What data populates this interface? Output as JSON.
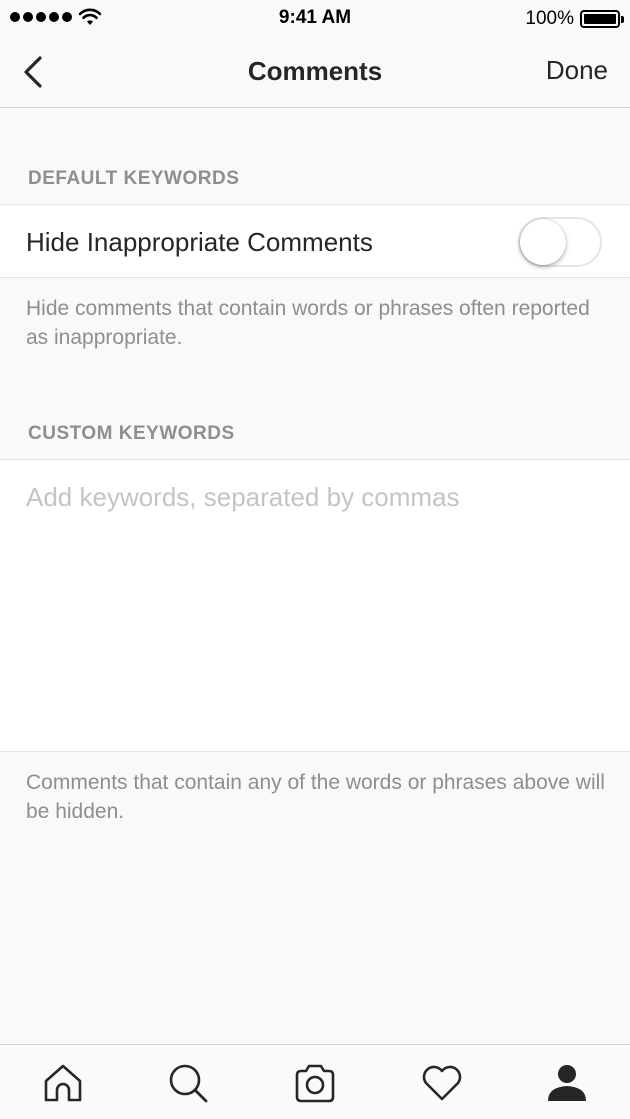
{
  "status_bar": {
    "time": "9:41 AM",
    "battery": "100%"
  },
  "nav": {
    "title": "Comments",
    "done_label": "Done",
    "back_icon": "chevron-left-icon"
  },
  "default_keywords": {
    "header": "DEFAULT KEYWORDS",
    "toggle_label": "Hide Inappropriate Comments",
    "toggle_on": false,
    "footnote": "Hide comments that contain words or phrases often reported as inappropriate."
  },
  "custom_keywords": {
    "header": "CUSTOM KEYWORDS",
    "input_value": "",
    "input_placeholder": "Add keywords, separated by commas",
    "footnote": "Comments that contain any of the words or phrases above will be hidden."
  },
  "tab_bar": {
    "items": [
      {
        "icon": "home-icon",
        "active": false
      },
      {
        "icon": "search-icon",
        "active": false
      },
      {
        "icon": "camera-icon",
        "active": false
      },
      {
        "icon": "heart-icon",
        "active": false
      },
      {
        "icon": "profile-icon",
        "active": true
      }
    ]
  },
  "colors": {
    "background": "#f9f9f9",
    "text": "#262626",
    "secondary_text": "#8e8e8e",
    "placeholder": "#c4c4c4"
  }
}
